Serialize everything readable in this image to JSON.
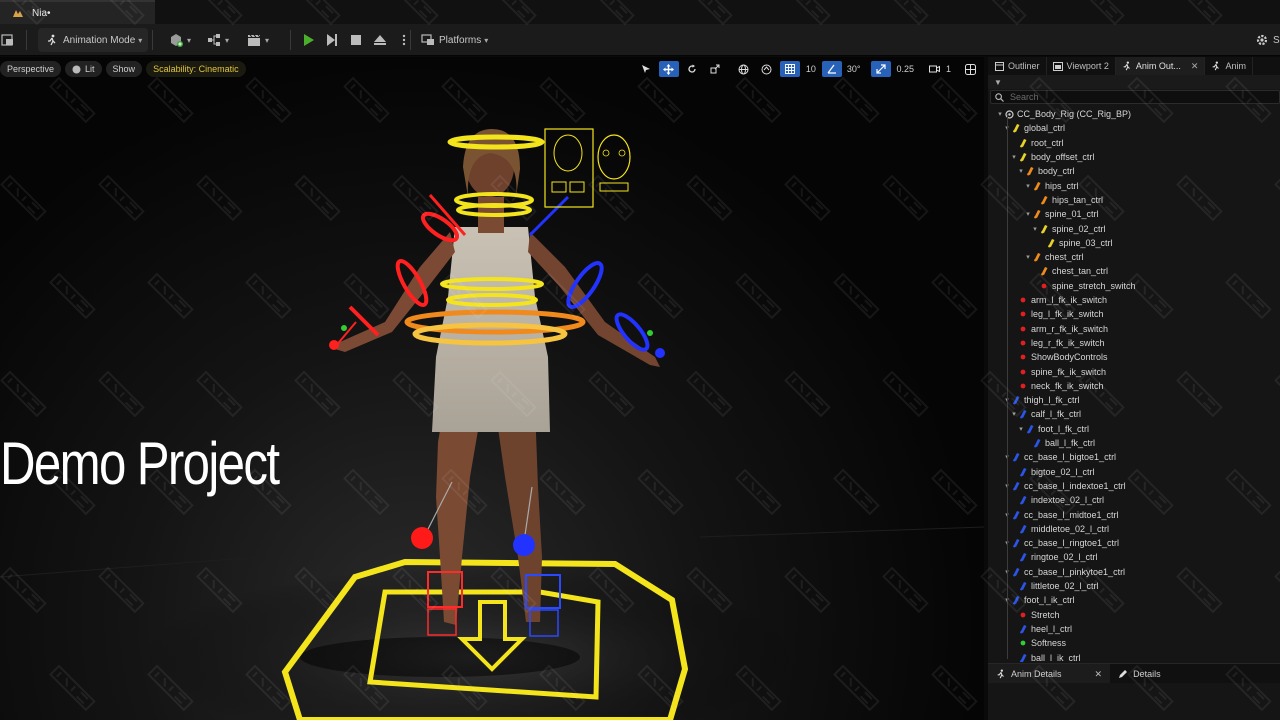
{
  "document_tab": {
    "title": "Nia•"
  },
  "toolbar": {
    "mode_label": "Animation Mode",
    "platforms_label": "Platforms",
    "settings_label": "S"
  },
  "viewport": {
    "perspective_label": "Perspective",
    "lit_label": "Lit",
    "show_label": "Show",
    "scalability_label": "Scalability: Cinematic",
    "grid_snap_value": "10",
    "rotation_snap_value": "30°",
    "scale_snap_value": "0.25",
    "camera_speed_value": "1",
    "overlay_title": "Demo Project"
  },
  "panel": {
    "tabs": [
      {
        "label": "Outliner"
      },
      {
        "label": "Viewport 2"
      },
      {
        "label": "Anim Out..."
      },
      {
        "label": "Anim"
      }
    ],
    "search_placeholder": "Search",
    "tree": [
      {
        "label": "CC_Body_Rig  (CC_Rig_BP)",
        "depth": 0,
        "icon": "rig-icon",
        "expanded": true
      },
      {
        "label": "global_ctrl",
        "depth": 1,
        "icon": "ctrl-icon-yellow",
        "expanded": true
      },
      {
        "label": "root_ctrl",
        "depth": 2,
        "icon": "ctrl-icon-yellow",
        "expanded": false
      },
      {
        "label": "body_offset_ctrl",
        "depth": 2,
        "icon": "ctrl-icon-yellow",
        "expanded": true
      },
      {
        "label": "body_ctrl",
        "depth": 3,
        "icon": "ctrl-icon-orange",
        "expanded": true
      },
      {
        "label": "hips_ctrl",
        "depth": 4,
        "icon": "ctrl-icon-orange",
        "expanded": true
      },
      {
        "label": "hips_tan_ctrl",
        "depth": 5,
        "icon": "ctrl-icon-orange",
        "expanded": false
      },
      {
        "label": "spine_01_ctrl",
        "depth": 4,
        "icon": "ctrl-icon-orange",
        "expanded": true
      },
      {
        "label": "spine_02_ctrl",
        "depth": 5,
        "icon": "ctrl-icon-yellow",
        "expanded": true
      },
      {
        "label": "spine_03_ctrl",
        "depth": 6,
        "icon": "ctrl-icon-yellow",
        "expanded": false
      },
      {
        "label": "chest_ctrl",
        "depth": 4,
        "icon": "ctrl-icon-orange",
        "expanded": true
      },
      {
        "label": "chest_tan_ctrl",
        "depth": 5,
        "icon": "ctrl-icon-orange",
        "expanded": false
      },
      {
        "label": "spine_stretch_switch",
        "depth": 5,
        "icon": "dot-red",
        "expanded": false
      },
      {
        "label": "arm_l_fk_ik_switch",
        "depth": 2,
        "icon": "dot-red",
        "expanded": false
      },
      {
        "label": "leg_l_fk_ik_switch",
        "depth": 2,
        "icon": "dot-red",
        "expanded": false
      },
      {
        "label": "arm_r_fk_ik_switch",
        "depth": 2,
        "icon": "dot-red",
        "expanded": false
      },
      {
        "label": "leg_r_fk_ik_switch",
        "depth": 2,
        "icon": "dot-red",
        "expanded": false
      },
      {
        "label": "ShowBodyControls",
        "depth": 2,
        "icon": "dot-red",
        "expanded": false
      },
      {
        "label": "spine_fk_ik_switch",
        "depth": 2,
        "icon": "dot-red",
        "expanded": false
      },
      {
        "label": "neck_fk_ik_switch",
        "depth": 2,
        "icon": "dot-red",
        "expanded": false
      },
      {
        "label": "thigh_l_fk_ctrl",
        "depth": 1,
        "icon": "ctrl-icon-blue",
        "expanded": true
      },
      {
        "label": "calf_l_fk_ctrl",
        "depth": 2,
        "icon": "ctrl-icon-blue",
        "expanded": true
      },
      {
        "label": "foot_l_fk_ctrl",
        "depth": 3,
        "icon": "ctrl-icon-blue",
        "expanded": true
      },
      {
        "label": "ball_l_fk_ctrl",
        "depth": 4,
        "icon": "ctrl-icon-blue",
        "expanded": false
      },
      {
        "label": "cc_base_l_bigtoe1_ctrl",
        "depth": 1,
        "icon": "ctrl-icon-blue",
        "expanded": true
      },
      {
        "label": "bigtoe_02_l_ctrl",
        "depth": 2,
        "icon": "ctrl-icon-blue",
        "expanded": false
      },
      {
        "label": "cc_base_l_indextoe1_ctrl",
        "depth": 1,
        "icon": "ctrl-icon-blue",
        "expanded": true
      },
      {
        "label": "indextoe_02_l_ctrl",
        "depth": 2,
        "icon": "ctrl-icon-blue",
        "expanded": false
      },
      {
        "label": "cc_base_l_midtoe1_ctrl",
        "depth": 1,
        "icon": "ctrl-icon-blue",
        "expanded": true
      },
      {
        "label": "middletoe_02_l_ctrl",
        "depth": 2,
        "icon": "ctrl-icon-blue",
        "expanded": false
      },
      {
        "label": "cc_base_l_ringtoe1_ctrl",
        "depth": 1,
        "icon": "ctrl-icon-blue",
        "expanded": true
      },
      {
        "label": "ringtoe_02_l_ctrl",
        "depth": 2,
        "icon": "ctrl-icon-blue",
        "expanded": false
      },
      {
        "label": "cc_base_l_pinkytoe1_ctrl",
        "depth": 1,
        "icon": "ctrl-icon-blue",
        "expanded": true
      },
      {
        "label": "littletoe_02_l_ctrl",
        "depth": 2,
        "icon": "ctrl-icon-blue",
        "expanded": false
      },
      {
        "label": "foot_l_ik_ctrl",
        "depth": 1,
        "icon": "ctrl-icon-blue",
        "expanded": true
      },
      {
        "label": "Stretch",
        "depth": 2,
        "icon": "dot-red",
        "expanded": false
      },
      {
        "label": "heel_l_ctrl",
        "depth": 2,
        "icon": "ctrl-icon-blue",
        "expanded": false
      },
      {
        "label": "Softness",
        "depth": 2,
        "icon": "dot-green",
        "expanded": false
      },
      {
        "label": "ball_l_ik_ctrl",
        "depth": 2,
        "icon": "ctrl-icon-blue",
        "expanded": false
      }
    ],
    "bottom_tabs": [
      {
        "label": "Anim Details"
      },
      {
        "label": "Details"
      }
    ]
  },
  "colors": {
    "accent_blue": "#2862b8",
    "play_green": "#4caf2c",
    "scalability_yellow": "#e1c43b",
    "ctrl_yellow": "#e8d22a",
    "ctrl_orange": "#f08a1c",
    "ctrl_blue": "#2a55e6",
    "dot_red": "#e02020",
    "dot_green": "#33cc33"
  }
}
